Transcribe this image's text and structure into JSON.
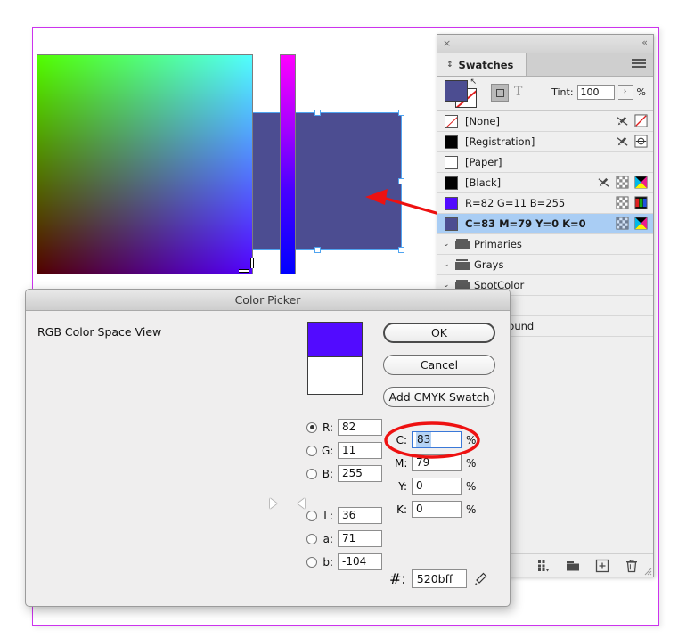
{
  "document": {
    "rect_left_color": "#520bff",
    "rect_right_color": "#4c4d91",
    "page_border_color": "#cc33ee",
    "selection_color": "#4fa4f0"
  },
  "swatches_panel": {
    "title": "Swatches",
    "close_glyph": "×",
    "collapse_glyph": "«",
    "diamond_glyph": "↕",
    "tint_label": "Tint:",
    "tint_value": "100",
    "tint_unit": "%",
    "tint_stepper_glyph": "›",
    "text_format_glyph": "T",
    "fill_color": "#4c4d91",
    "rows": [
      {
        "name": "[None]",
        "type": "none",
        "chip": "none",
        "selected": false,
        "icons": [
          "eyedropper-crossed",
          "none-mode"
        ]
      },
      {
        "name": "[Registration]",
        "type": "color",
        "chip": "#000000",
        "selected": false,
        "icons": [
          "eyedropper-crossed",
          "registration-mode"
        ]
      },
      {
        "name": "[Paper]",
        "type": "color",
        "chip": "#ffffff",
        "selected": false,
        "icons": []
      },
      {
        "name": "[Black]",
        "type": "color",
        "chip": "#000000",
        "selected": false,
        "icons": [
          "eyedropper-crossed",
          "tint-grid",
          "cmyk-mode"
        ]
      },
      {
        "name": "R=82 G=11 B=255",
        "type": "color",
        "chip": "#520bff",
        "selected": false,
        "icons": [
          "tint-grid",
          "rgb-mode"
        ]
      },
      {
        "name": "C=83 M=79 Y=0 K=0",
        "type": "color",
        "chip": "#4c4d91",
        "selected": true,
        "icons": [
          "tint-grid",
          "cmyk-mode"
        ]
      }
    ],
    "groups": [
      {
        "name": "Primaries"
      },
      {
        "name": "Grays"
      },
      {
        "name": "SpotColor"
      }
    ],
    "partial_rows": [
      {
        "name": ""
      },
      {
        "name": "pound"
      }
    ],
    "footer_icons": [
      {
        "name": "color-group-icon"
      },
      {
        "name": "new-color-group-folder-icon"
      },
      {
        "name": "new-swatch-icon"
      },
      {
        "name": "delete-swatch-icon"
      }
    ]
  },
  "color_picker": {
    "title": "Color Picker",
    "mode_label": "RGB Color Space View",
    "buttons": {
      "ok": "OK",
      "cancel": "Cancel",
      "add_cmyk": "Add CMYK Swatch"
    },
    "preview_new_color": "#520bff",
    "preview_old_color": "#ffffff",
    "rgb_fields": [
      {
        "key": "R:",
        "value": "82",
        "selected": true
      },
      {
        "key": "G:",
        "value": "11",
        "selected": false
      },
      {
        "key": "B:",
        "value": "255",
        "selected": false
      }
    ],
    "lab_fields": [
      {
        "key": "L:",
        "value": "36",
        "selected": false
      },
      {
        "key": "a:",
        "value": "71",
        "selected": false
      },
      {
        "key": "b:",
        "value": "-104",
        "selected": false
      }
    ],
    "cmyk_fields": [
      {
        "key": "C:",
        "value": "83",
        "unit": "%",
        "active": true
      },
      {
        "key": "M:",
        "value": "79",
        "unit": "%",
        "active": false
      },
      {
        "key": "Y:",
        "value": "0",
        "unit": "%",
        "active": false
      },
      {
        "key": "K:",
        "value": "0",
        "unit": "%",
        "active": false
      }
    ],
    "hex_label": "#:",
    "hex_value": "520bff"
  },
  "annotations": {
    "arrow_color": "#ee1111",
    "ellipse_color": "#ee1111"
  }
}
